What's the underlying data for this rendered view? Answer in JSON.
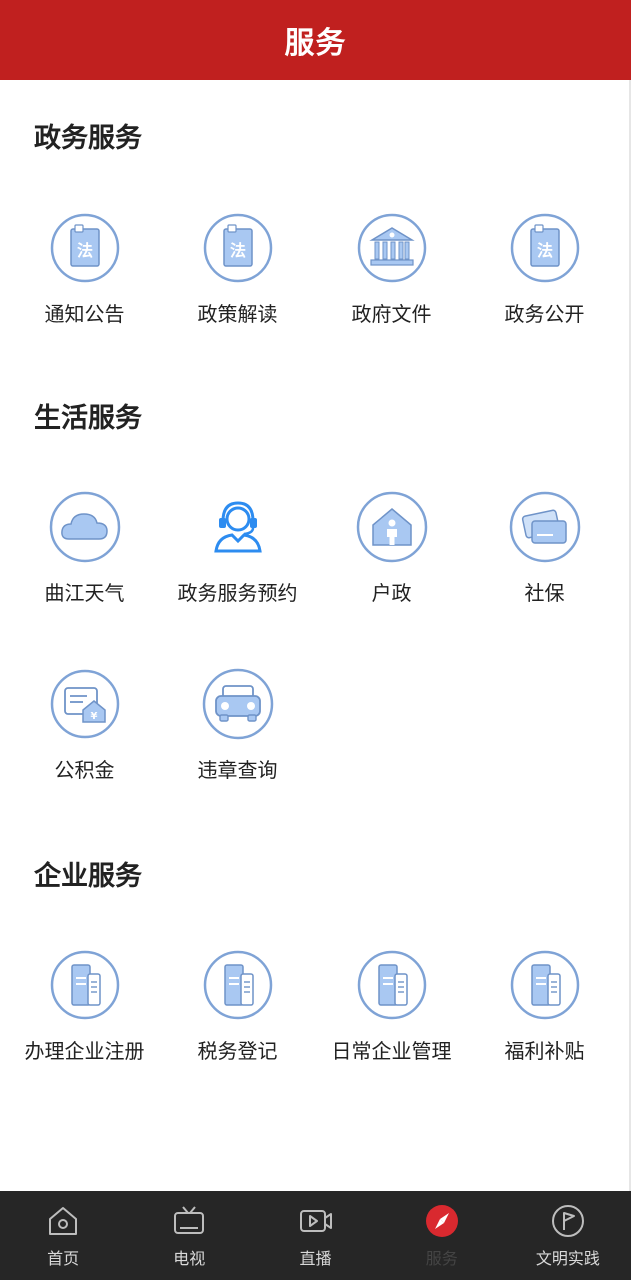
{
  "header": {
    "title": "服务"
  },
  "sections": [
    {
      "title": "政务服务",
      "items": [
        {
          "label": "通知公告",
          "icon": "law-book-icon"
        },
        {
          "label": "政策解读",
          "icon": "law-book-icon"
        },
        {
          "label": "政府文件",
          "icon": "government-building-icon"
        },
        {
          "label": "政务公开",
          "icon": "law-book-icon"
        }
      ]
    },
    {
      "title": "生活服务",
      "items": [
        {
          "label": "曲江天气",
          "icon": "cloud-icon"
        },
        {
          "label": "政务服务预约",
          "icon": "headset-agent-icon"
        },
        {
          "label": "户政",
          "icon": "person-house-icon"
        },
        {
          "label": "社保",
          "icon": "social-security-card-icon"
        },
        {
          "label": "公积金",
          "icon": "housing-fund-icon"
        },
        {
          "label": "违章查询",
          "icon": "car-icon"
        }
      ]
    },
    {
      "title": "企业服务",
      "items": [
        {
          "label": "办理企业注册",
          "icon": "enterprise-building-icon"
        },
        {
          "label": "税务登记",
          "icon": "enterprise-building-icon"
        },
        {
          "label": "日常企业管理",
          "icon": "enterprise-building-icon"
        },
        {
          "label": "福利补贴",
          "icon": "enterprise-building-icon"
        }
      ]
    }
  ],
  "tabbar": {
    "items": [
      {
        "label": "首页",
        "icon": "home-icon"
      },
      {
        "label": "电视",
        "icon": "tv-icon"
      },
      {
        "label": "直播",
        "icon": "live-video-icon"
      },
      {
        "label": "服务",
        "icon": "compass-icon",
        "active": true
      },
      {
        "label": "文明实践",
        "icon": "flag-circle-icon"
      }
    ]
  },
  "colors": {
    "brand": "#c0201f",
    "icon_stroke": "#7fa3d6",
    "icon_fill": "#a9c8f2",
    "tabbar_bg": "#262626",
    "active_tab": "#d9292f"
  }
}
